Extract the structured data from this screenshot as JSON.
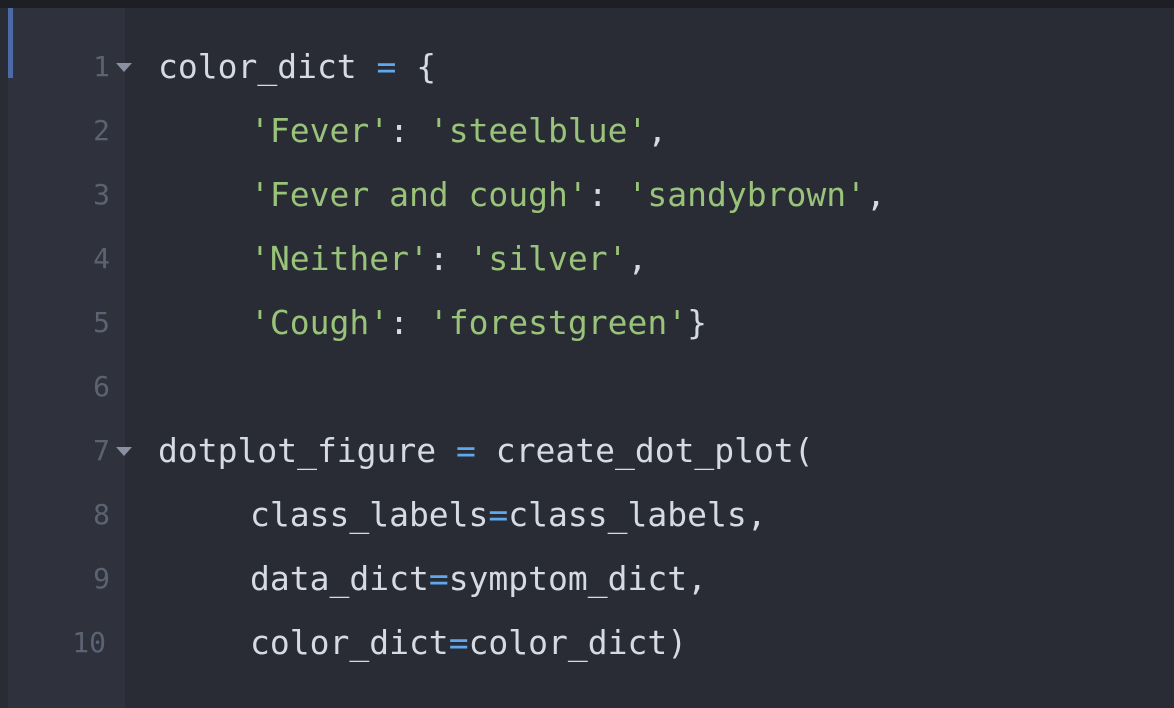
{
  "editor": {
    "lines": [
      {
        "number": "1",
        "foldable": true,
        "tokens": [
          {
            "t": "plain",
            "v": "color_dict "
          },
          {
            "t": "op",
            "v": "="
          },
          {
            "t": "plain",
            "v": " {"
          }
        ]
      },
      {
        "number": "2",
        "foldable": false,
        "indent": true,
        "tokens": [
          {
            "t": "str",
            "v": "'Fever'"
          },
          {
            "t": "plain",
            "v": ": "
          },
          {
            "t": "str",
            "v": "'steelblue'"
          },
          {
            "t": "plain",
            "v": ","
          }
        ]
      },
      {
        "number": "3",
        "foldable": false,
        "indent": true,
        "tokens": [
          {
            "t": "str",
            "v": "'Fever and cough'"
          },
          {
            "t": "plain",
            "v": ": "
          },
          {
            "t": "str",
            "v": "'sandybrown'"
          },
          {
            "t": "plain",
            "v": ","
          }
        ]
      },
      {
        "number": "4",
        "foldable": false,
        "indent": true,
        "tokens": [
          {
            "t": "str",
            "v": "'Neither'"
          },
          {
            "t": "plain",
            "v": ": "
          },
          {
            "t": "str",
            "v": "'silver'"
          },
          {
            "t": "plain",
            "v": ","
          }
        ]
      },
      {
        "number": "5",
        "foldable": false,
        "indent": true,
        "tokens": [
          {
            "t": "str",
            "v": "'Cough'"
          },
          {
            "t": "plain",
            "v": ": "
          },
          {
            "t": "str",
            "v": "'forestgreen'"
          },
          {
            "t": "plain",
            "v": "}"
          }
        ]
      },
      {
        "number": "6",
        "foldable": false,
        "tokens": []
      },
      {
        "number": "7",
        "foldable": true,
        "tokens": [
          {
            "t": "plain",
            "v": "dotplot_figure "
          },
          {
            "t": "op",
            "v": "="
          },
          {
            "t": "plain",
            "v": " create_dot_plot("
          }
        ]
      },
      {
        "number": "8",
        "foldable": false,
        "indent": true,
        "tokens": [
          {
            "t": "plain",
            "v": "class_labels"
          },
          {
            "t": "op",
            "v": "="
          },
          {
            "t": "plain",
            "v": "class_labels,"
          }
        ]
      },
      {
        "number": "9",
        "foldable": false,
        "indent": true,
        "tokens": [
          {
            "t": "plain",
            "v": "data_dict"
          },
          {
            "t": "op",
            "v": "="
          },
          {
            "t": "plain",
            "v": "symptom_dict,"
          }
        ]
      },
      {
        "number": "10",
        "foldable": false,
        "indent": true,
        "tokens": [
          {
            "t": "plain",
            "v": "color_dict"
          },
          {
            "t": "op",
            "v": "="
          },
          {
            "t": "plain",
            "v": "color_dict)"
          }
        ]
      }
    ]
  },
  "colors": {
    "background": "#292c35",
    "gutter": "#2f323c",
    "string": "#98c379",
    "operator": "#5fa8ee",
    "text": "#d6dae3",
    "line_number": "#5b6272"
  }
}
